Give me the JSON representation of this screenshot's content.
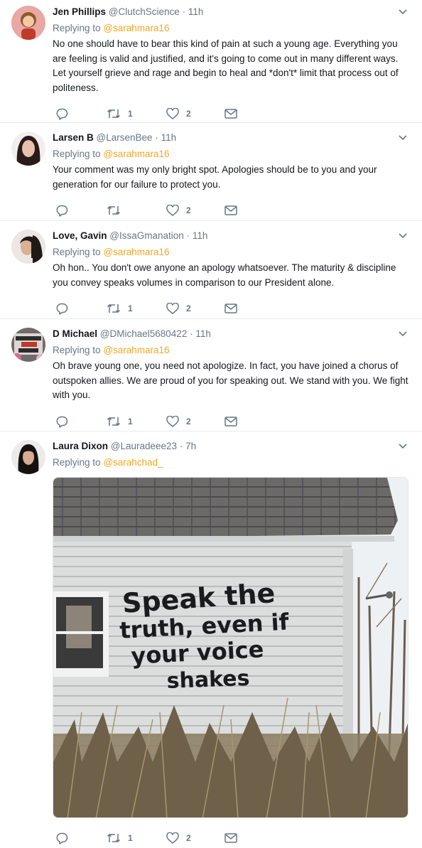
{
  "tweets": [
    {
      "name": "Jen Phillips",
      "handle": "@ClutchScience",
      "time": "11h",
      "replying_label": "Replying to",
      "replying_to": "@sarahmara16",
      "text": "No one should have to bear this kind of pain at such a young age. Everything you are feeling is valid and justified, and it's going to come out in many different ways. Let yourself grieve and rage and begin to heal and *don't* limit that process out of politeness.",
      "retweets": "1",
      "likes": "2"
    },
    {
      "name": "Larsen B",
      "handle": "@LarsenBee",
      "time": "11h",
      "replying_label": "Replying to",
      "replying_to": "@sarahmara16",
      "text": "Your comment was my only bright spot. Apologies should be to you and your generation for our failure to protect you.",
      "retweets": "",
      "likes": "2"
    },
    {
      "name": "Love, Gavin",
      "handle": "@IssaGmanation",
      "time": "11h",
      "replying_label": "Replying to",
      "replying_to": "@sarahmara16",
      "text": "Oh hon.. You don't owe anyone an apology whatsoever. The maturity & discipline you convey speaks volumes in comparison to our President alone.",
      "retweets": "1",
      "likes": "2"
    },
    {
      "name": "D Michael",
      "handle": "@DMichael5680422",
      "time": "11h",
      "replying_label": "Replying to",
      "replying_to": "@sarahmara16",
      "text": "Oh brave young one, you need not apologize. In fact, you have joined a chorus of outspoken allies. We are proud of you for speaking out. We stand with you. We fight with you.",
      "retweets": "1",
      "likes": "2"
    },
    {
      "name": "Laura Dixon",
      "handle": "@Lauradeee23",
      "time": "7h",
      "replying_label": "Replying to",
      "replying_to": "@sarahchad_",
      "text": "",
      "retweets": "1",
      "likes": "2",
      "photo_text": [
        "Speak the",
        "truth, even if",
        "your voice",
        "shakes"
      ]
    }
  ],
  "colors": {
    "accent": "#f5a623",
    "secondary_text": "#657786",
    "divider": "#e6ecf0"
  },
  "icons": [
    "reply-icon",
    "retweet-icon",
    "like-icon",
    "direct-message-icon",
    "chevron-down-icon"
  ]
}
